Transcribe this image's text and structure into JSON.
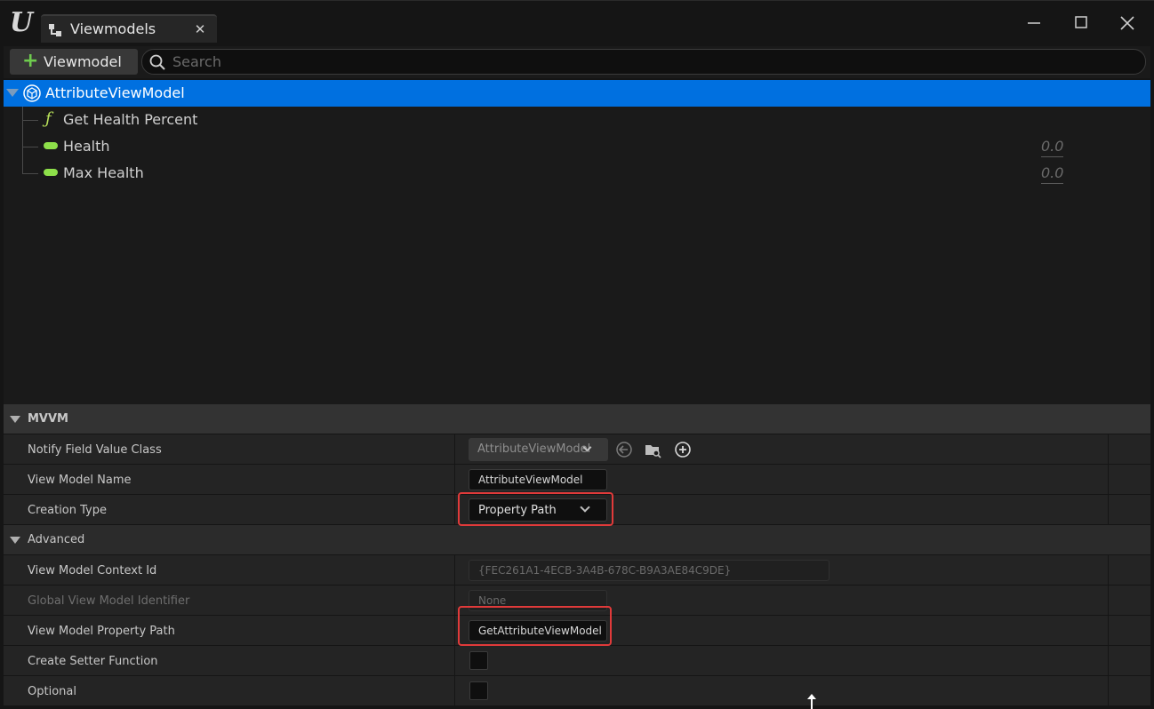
{
  "window": {
    "tab_title": "Viewmodels",
    "close_glyph": "✕",
    "minimize_glyph": "—",
    "maximize_glyph": "☐",
    "close_window_glyph": "✕"
  },
  "toolbar": {
    "add_label": "Viewmodel",
    "add_glyph": "+",
    "search_placeholder": "Search"
  },
  "tree": {
    "root": "AttributeViewModel",
    "children": [
      {
        "label": "Get Health Percent",
        "kind": "function",
        "glyph": "ƒ"
      },
      {
        "label": "Health",
        "kind": "property",
        "value": "0.0"
      },
      {
        "label": "Max Health",
        "kind": "property",
        "value": "0.0"
      }
    ]
  },
  "details": {
    "category_mvvm": "MVVM",
    "category_advanced": "Advanced",
    "rows": {
      "notify_class": {
        "name": "Notify Field Value Class",
        "value": "AttributeViewModel"
      },
      "vm_name": {
        "name": "View Model Name",
        "value": "AttributeViewModel"
      },
      "creation_type": {
        "name": "Creation Type",
        "value": "Property Path"
      },
      "context_id": {
        "name": "View Model Context Id",
        "value": "{FEC261A1-4ECB-3A4B-678C-B9A3AE84C9DE}"
      },
      "global_id": {
        "name": "Global View Model Identifier",
        "value": "None"
      },
      "property_path": {
        "name": "View Model Property Path",
        "value": "GetAttributeViewModel"
      },
      "setter": {
        "name": "Create Setter Function"
      },
      "optional": {
        "name": "Optional"
      }
    }
  },
  "colors": {
    "selection": "#0070e0",
    "accent_green": "#8ee04a",
    "highlight_red": "#e03a3a"
  }
}
